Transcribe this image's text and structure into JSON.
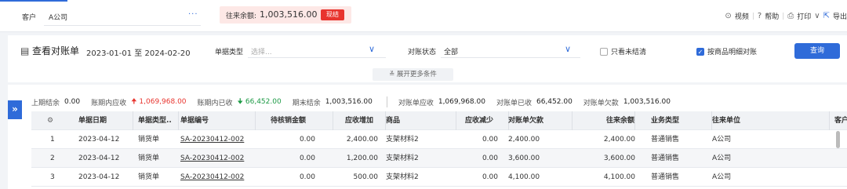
{
  "header": {
    "customer_label": "客户",
    "customer_value": "A公司",
    "customer_more": "···",
    "balance_label": "往来余额:",
    "balance_value": "1,003,516.00",
    "balance_button": "现结",
    "tools": {
      "video": "视频",
      "help": "帮助",
      "print": "打印",
      "export": "导出"
    },
    "accent_color": "#2f6bd9"
  },
  "filter": {
    "title": "查看对账单",
    "date_range": "2023-01-01 至 2024-02-20",
    "doc_type_label": "单据类型",
    "doc_type_placeholder": "选择...",
    "status_label": "对账状态",
    "status_value": "全部",
    "only_unsettled_label": "只看未结清",
    "only_unsettled_checked": false,
    "by_item_label": "按商品明细对账",
    "by_item_checked": true,
    "query_button": "查询",
    "expand_label": "展开更多条件"
  },
  "summary": {
    "opening_label": "上期结余",
    "opening_value": "0.00",
    "period_receivable_label": "账期内应收",
    "period_receivable_value": "1,069,968.00",
    "period_received_label": "账期内已收",
    "period_received_value": "66,452.00",
    "closing_label": "期末结余",
    "closing_value": "1,003,516.00",
    "stmt_receivable_label": "对账单应收",
    "stmt_receivable_value": "1,069,968.00",
    "stmt_received_label": "对账单已收",
    "stmt_received_value": "66,452.00",
    "stmt_owed_label": "对账单欠款",
    "stmt_owed_value": "1,003,516.00"
  },
  "table": {
    "columns": [
      "单据日期",
      "单据类型..",
      "单据编号",
      "待核销金额",
      "应收增加",
      "商品",
      "应收减少",
      "对账单欠款",
      "往来余额",
      "业务类型",
      "往来单位",
      "客户"
    ],
    "rows": [
      {
        "idx": "1",
        "date": "2023-04-12",
        "type": "销货单",
        "no": "SA-20230412-002",
        "pending": "0.00",
        "rec_inc": "2,400.00",
        "goods": "支架材料2",
        "rec_dec": "0.00",
        "owed": "2,400.00",
        "balance": "2,400.00",
        "biz": "普通销售",
        "unit": "A公司"
      },
      {
        "idx": "2",
        "date": "2023-04-12",
        "type": "销货单",
        "no": "SA-20230412-002",
        "pending": "0.00",
        "rec_inc": "1,200.00",
        "goods": "支架材料2",
        "rec_dec": "0.00",
        "owed": "3,600.00",
        "balance": "3,600.00",
        "biz": "普通销售",
        "unit": "A公司"
      },
      {
        "idx": "3",
        "date": "2023-04-12",
        "type": "销货单",
        "no": "SA-20230412-002",
        "pending": "0.00",
        "rec_inc": "500.00",
        "goods": "支架材料2",
        "rec_dec": "0.00",
        "owed": "4,100.00",
        "balance": "4,100.00",
        "biz": "普通销售",
        "unit": "A公司"
      }
    ]
  }
}
